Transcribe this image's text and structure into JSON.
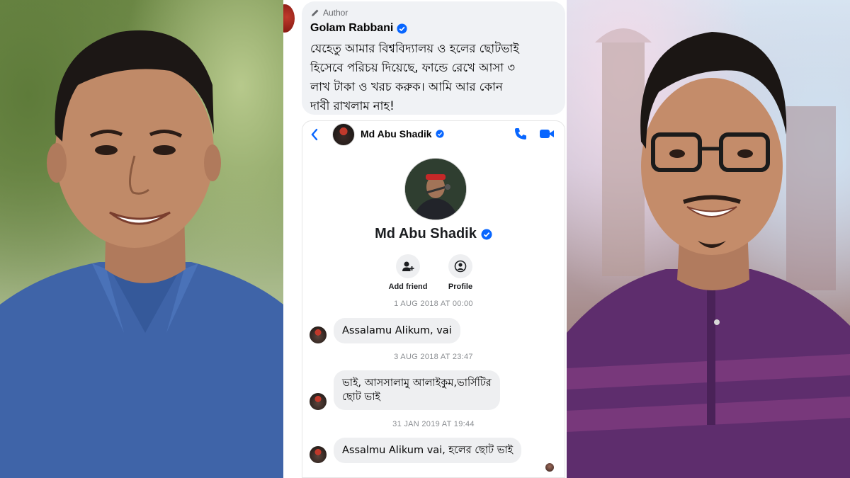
{
  "post": {
    "author_tag": "Author",
    "author_name": "Golam Rabbani",
    "comment_line_1": "যেহেতু আমার বিশ্ববিদ্যালয় ও হলের ছোটভাই",
    "comment_line_2": "হিসেবে পরিচয় দিয়েছে, ফান্ডে রেখে আসা ৩",
    "comment_line_3": "লাখ টাকা ও খরচ করুক। আমি আর কোন",
    "comment_line_4": "দাবী রাখলাম নাহ!"
  },
  "messenger": {
    "header_name": "Md Abu Shadik",
    "profile_name": "Md Abu Shadik",
    "actions": [
      {
        "label": "Add friend",
        "icon": "add-friend-icon"
      },
      {
        "label": "Profile",
        "icon": "profile-icon"
      }
    ],
    "conversation": [
      {
        "timestamp": "1 AUG 2018 AT 00:00",
        "lines": [
          "Assalamu Alikum, vai"
        ]
      },
      {
        "timestamp": "3 AUG 2018 AT 23:47",
        "lines": [
          "ভাই, আসসালামু আলাইকুম,ভার্সিটির",
          "ছোট ভাই"
        ]
      },
      {
        "timestamp": "31 JAN 2019 AT 19:44",
        "lines": [
          "Assalmu Alikum vai, হলের ছোট ভাই"
        ]
      }
    ]
  },
  "colors": {
    "accent": "#0866ff",
    "bubble": "#eeeff1",
    "comment_bg": "#f0f2f5",
    "left_shirt": "#3f64a8",
    "right_shirt": "#5e2d6d"
  }
}
